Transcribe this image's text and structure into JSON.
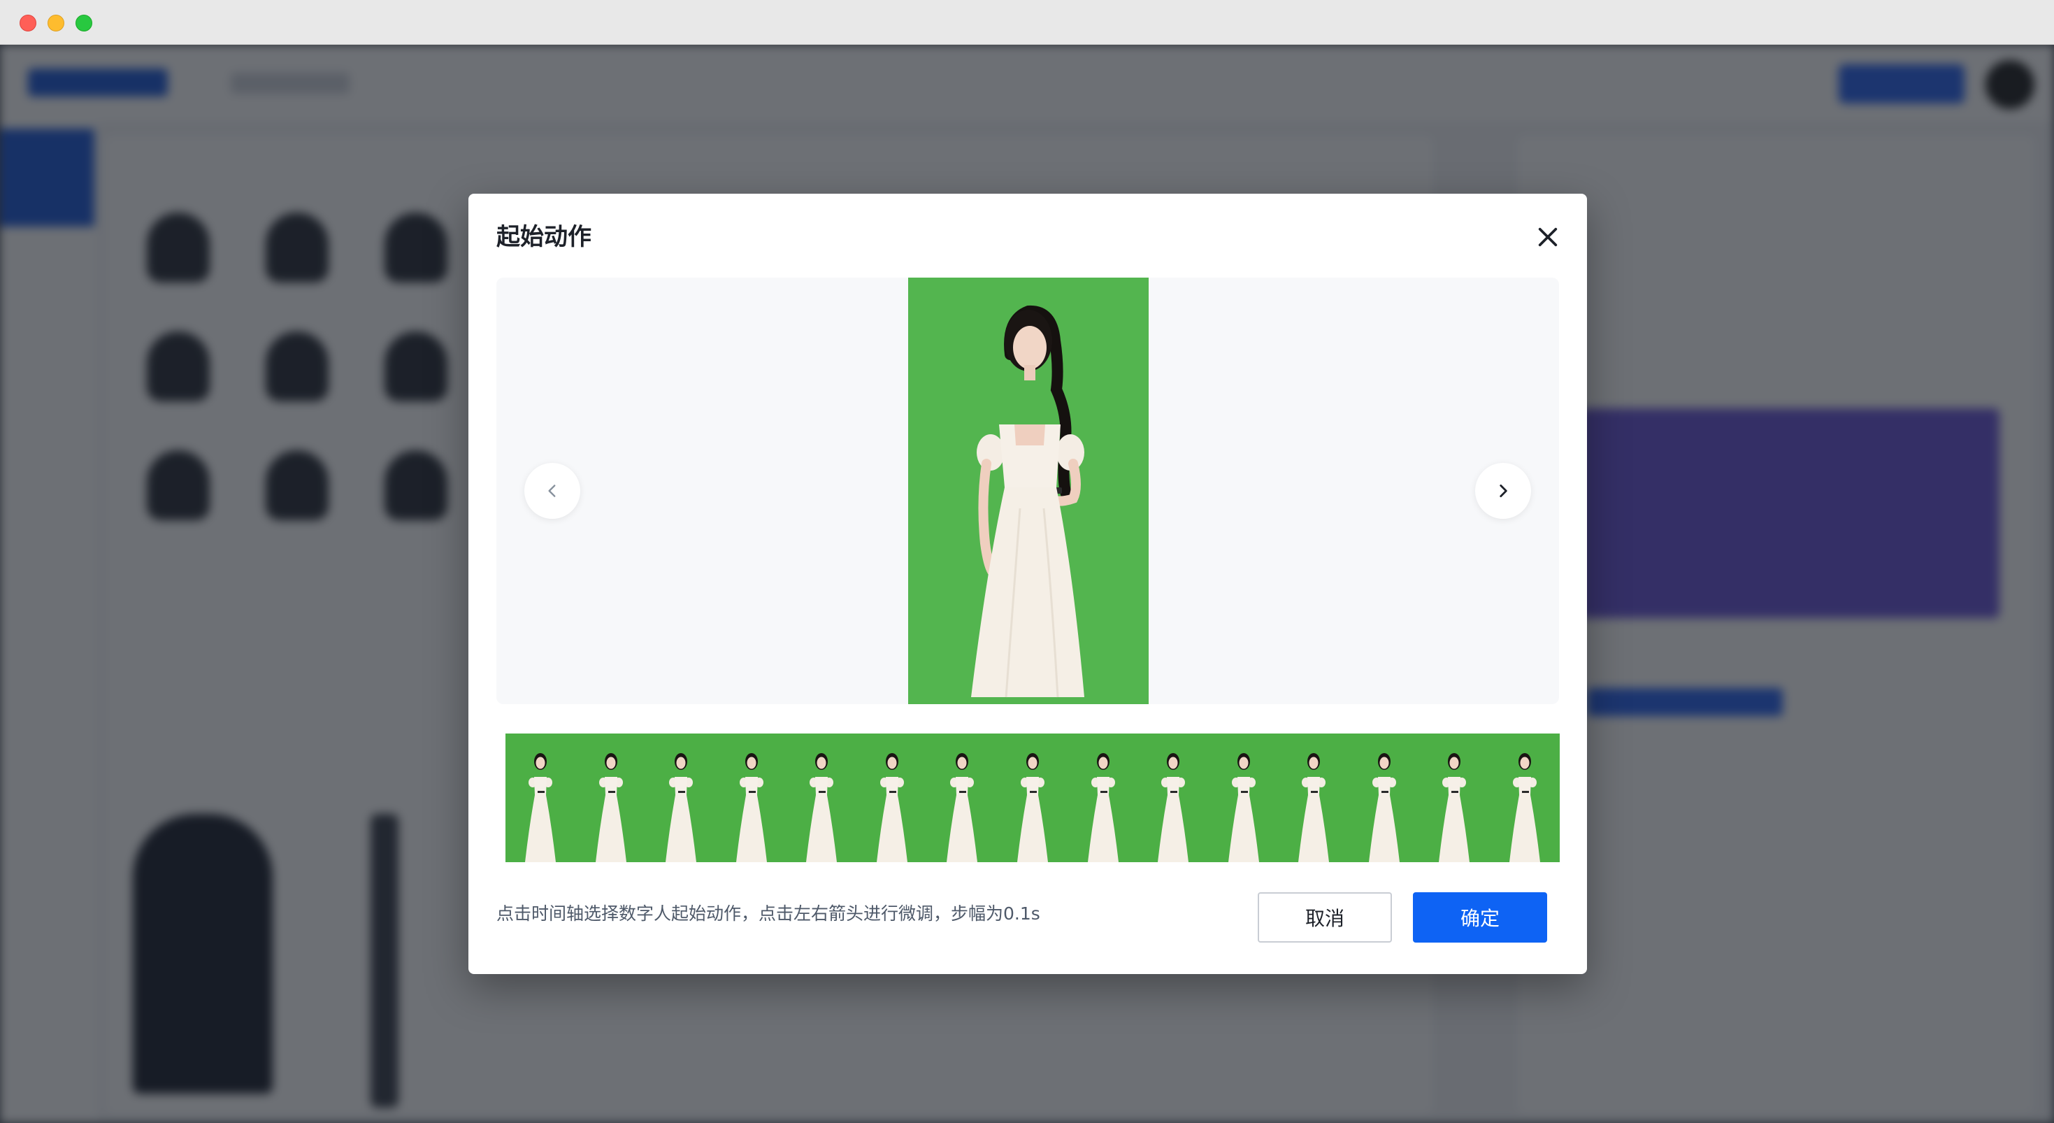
{
  "window": {
    "traffic_lights": [
      "close",
      "minimize",
      "zoom"
    ]
  },
  "modal": {
    "title": "起始动作",
    "close_icon": "close-icon",
    "preview": {
      "background_color": "#53b54f",
      "prev_icon": "chevron-left-icon",
      "next_icon": "chevron-right-icon"
    },
    "timeline": {
      "frame_count": 15,
      "background_color": "#4caf45"
    },
    "hint": "点击时间轴选择数字人起始动作，点击左右箭头进行微调，步幅为0.1s",
    "cancel_label": "取消",
    "confirm_label": "确定",
    "accent_color": "#0e63f4"
  }
}
